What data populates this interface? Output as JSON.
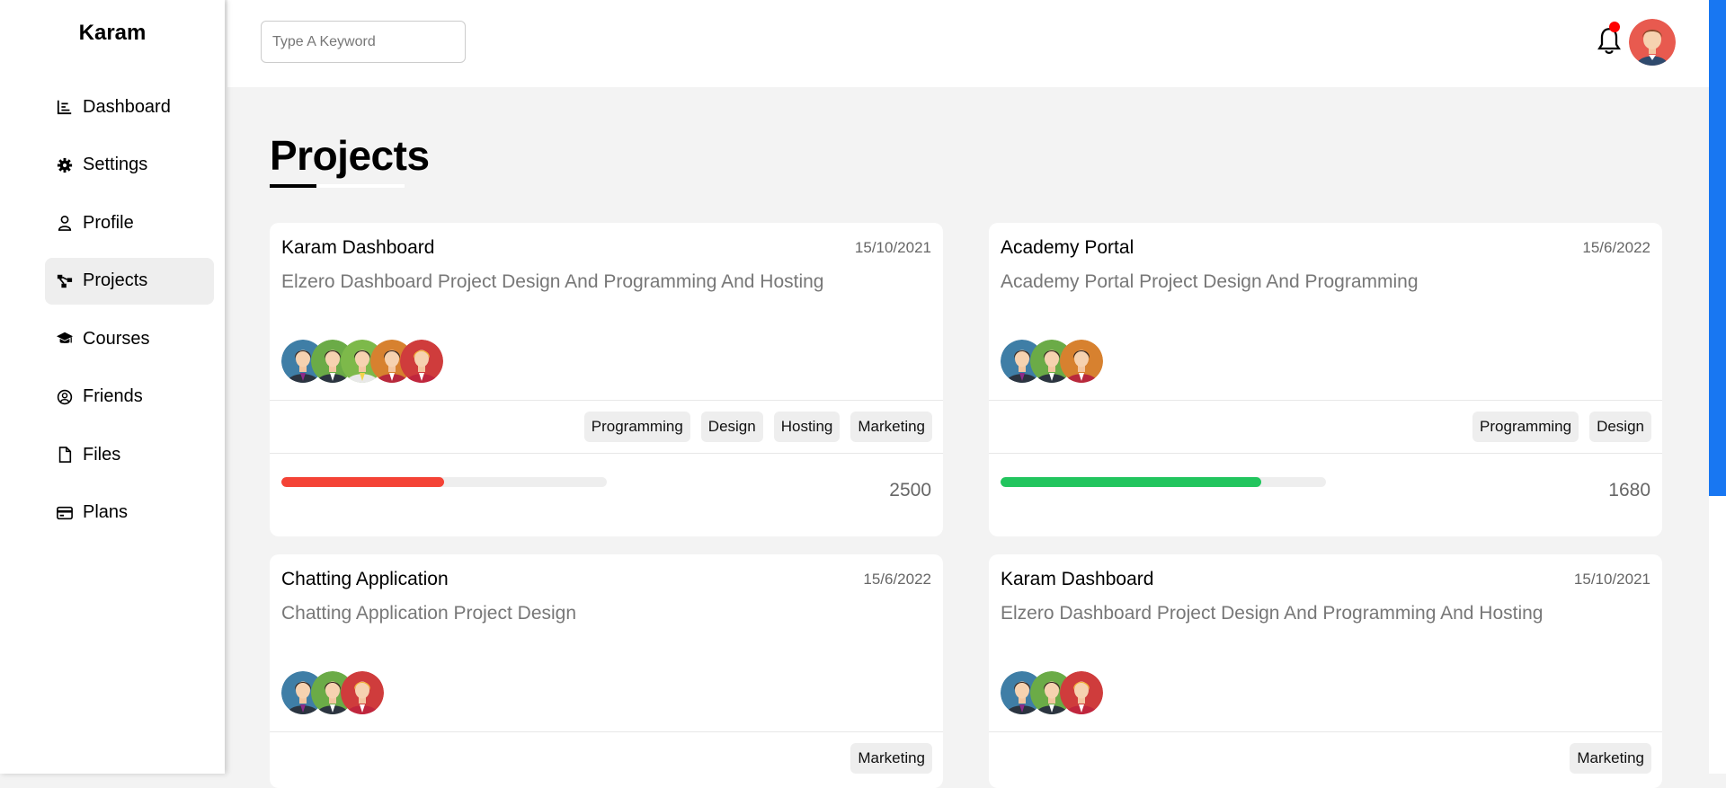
{
  "brand": "Karam",
  "nav": [
    {
      "label": "Dashboard",
      "icon": "chart-icon",
      "active": false
    },
    {
      "label": "Settings",
      "icon": "gear-icon",
      "active": false
    },
    {
      "label": "Profile",
      "icon": "user-icon",
      "active": false
    },
    {
      "label": "Projects",
      "icon": "diagram-icon",
      "active": true
    },
    {
      "label": "Courses",
      "icon": "graduation-cap-icon",
      "active": false
    },
    {
      "label": "Friends",
      "icon": "user-circle-icon",
      "active": false
    },
    {
      "label": "Files",
      "icon": "file-icon",
      "active": false
    },
    {
      "label": "Plans",
      "icon": "credit-card-icon",
      "active": false
    }
  ],
  "header": {
    "search_placeholder": "Type A Keyword",
    "search_value": "",
    "notification_icon": "bell-icon",
    "has_notification": true
  },
  "main": {
    "title": "Projects",
    "projects": [
      {
        "name": "Karam Dashboard",
        "date": "15/10/2021",
        "description": "Elzero Dashboard Project Design And Programming And Hosting",
        "team_count": 5,
        "tags": [
          "Programming",
          "Design",
          "Hosting",
          "Marketing"
        ],
        "progress": 0.5,
        "progress_color": "#f44336",
        "amount": "2500"
      },
      {
        "name": "Academy Portal",
        "date": "15/6/2022",
        "description": "Academy Portal Project Design And Programming",
        "team_count": 3,
        "tags": [
          "Programming",
          "Design"
        ],
        "progress": 0.8,
        "progress_color": "#22c55e",
        "amount": "1680"
      },
      {
        "name": "Chatting Application",
        "date": "15/6/2022",
        "description": "Chatting Application Project Design",
        "team_count": 3,
        "tags": [
          "Marketing"
        ],
        "progress": null,
        "progress_color": "",
        "amount": ""
      },
      {
        "name": "Karam Dashboard",
        "date": "15/10/2021",
        "description": "Elzero Dashboard Project Design And Programming And Hosting",
        "team_count": 3,
        "tags": [
          "Marketing"
        ],
        "progress": null,
        "progress_color": "",
        "amount": ""
      }
    ]
  },
  "colors": {
    "accent": "#1877f2",
    "background": "#f3f3f3",
    "card": "#ffffff"
  }
}
